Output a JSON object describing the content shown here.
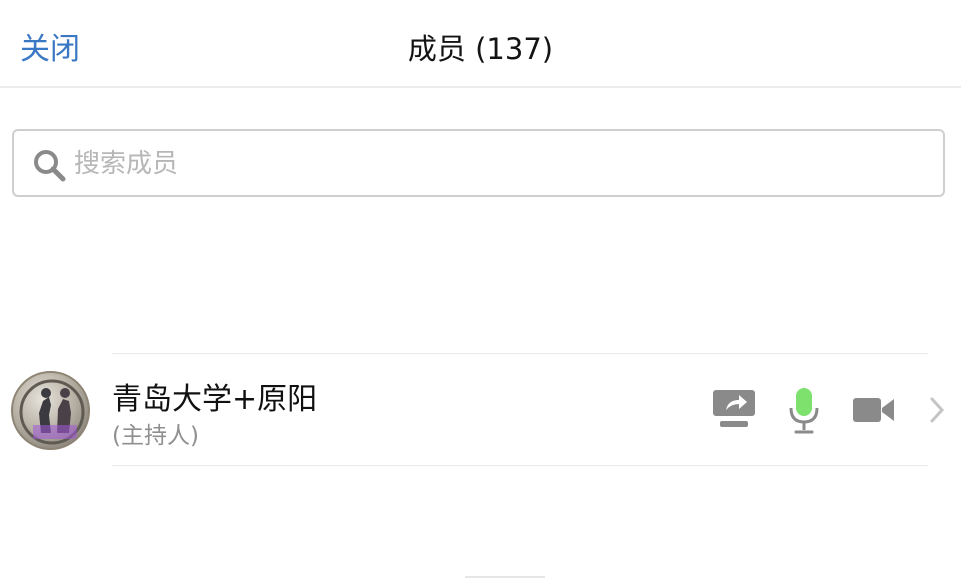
{
  "header": {
    "close_label": "关闭",
    "title": "成员 (137)"
  },
  "search": {
    "placeholder": "搜索成员"
  },
  "members": [
    {
      "name": "青岛大学+原阳",
      "role": "(主持人)",
      "mic_status": "active"
    }
  ],
  "colors": {
    "accent": "#3a78c4",
    "mic_active": "#7ee06d",
    "icon_gray": "#8a8a8a"
  },
  "icons": [
    "search-icon",
    "share-screen-icon",
    "microphone-icon",
    "video-camera-icon",
    "chevron-right-icon"
  ]
}
